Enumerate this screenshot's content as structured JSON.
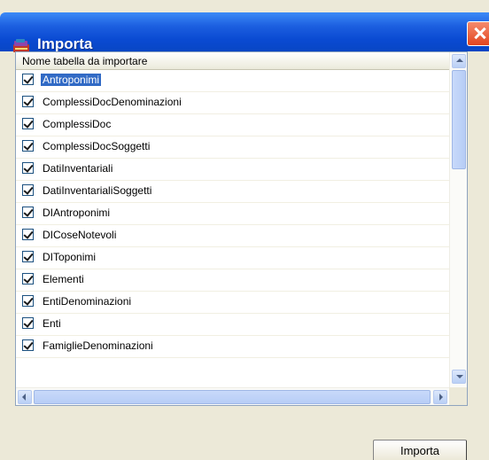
{
  "window": {
    "title": "Importa",
    "title_icon": "books-icon",
    "close_icon": "close-icon"
  },
  "list": {
    "column_header": "Nome tabella da importare",
    "items": [
      {
        "label": "Antroponimi",
        "checked": true,
        "selected": true
      },
      {
        "label": "ComplessiDocDenominazioni",
        "checked": true
      },
      {
        "label": "ComplessiDoc",
        "checked": true
      },
      {
        "label": "ComplessiDocSoggetti",
        "checked": true
      },
      {
        "label": "DatiInventariali",
        "checked": true
      },
      {
        "label": "DatiInventarialiSoggetti",
        "checked": true
      },
      {
        "label": "DIAntroponimi",
        "checked": true
      },
      {
        "label": "DICoseNotevoli",
        "checked": true
      },
      {
        "label": "DIToponimi",
        "checked": true
      },
      {
        "label": "Elementi",
        "checked": true
      },
      {
        "label": "EntiDenominazioni",
        "checked": true
      },
      {
        "label": "Enti",
        "checked": true
      },
      {
        "label": "FamiglieDenominazioni",
        "checked": true
      }
    ]
  },
  "buttons": {
    "import_label": "Importa"
  },
  "colors": {
    "titlebar": "#0a4ad2",
    "selection": "#316ac5",
    "window_bg": "#ece9d8"
  }
}
